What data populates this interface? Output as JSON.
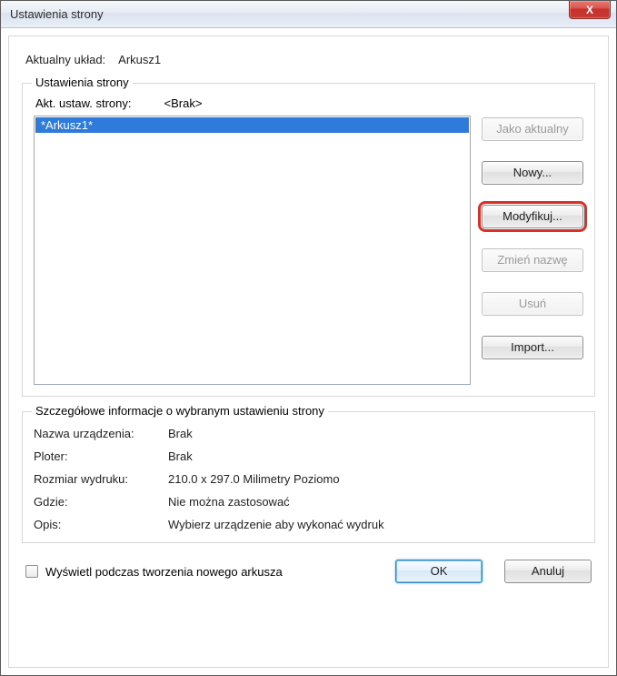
{
  "window": {
    "title": "Ustawienia strony"
  },
  "close_label": "X",
  "current_layout": {
    "label": "Aktualny układ:",
    "value": "Arkusz1"
  },
  "group_settings": {
    "title": "Ustawienia strony",
    "akt_label": "Akt. ustaw. strony:",
    "akt_value": "<Brak>",
    "list": [
      "*Arkusz1*"
    ],
    "buttons": {
      "as_current": "Jako aktualny",
      "new": "Nowy...",
      "modify": "Modyfikuj...",
      "rename": "Zmień nazwę",
      "delete": "Usuń",
      "import": "Import..."
    }
  },
  "details": {
    "title": "Szczegółowe informacje o wybranym ustawieniu strony",
    "rows": {
      "device_label": "Nazwa urządzenia:",
      "device_value": "Brak",
      "plotter_label": "Ploter:",
      "plotter_value": "Brak",
      "size_label": "Rozmiar wydruku:",
      "size_value": "210.0 x 297.0 Milimetry Poziomo",
      "where_label": "Gdzie:",
      "where_value": "Nie można zastosować",
      "desc_label": "Opis:",
      "desc_value": "Wybierz urządzenie aby wykonać wydruk"
    }
  },
  "bottom": {
    "checkbox_label": "Wyświetl podczas tworzenia nowego arkusza",
    "ok": "OK",
    "cancel": "Anuluj"
  }
}
